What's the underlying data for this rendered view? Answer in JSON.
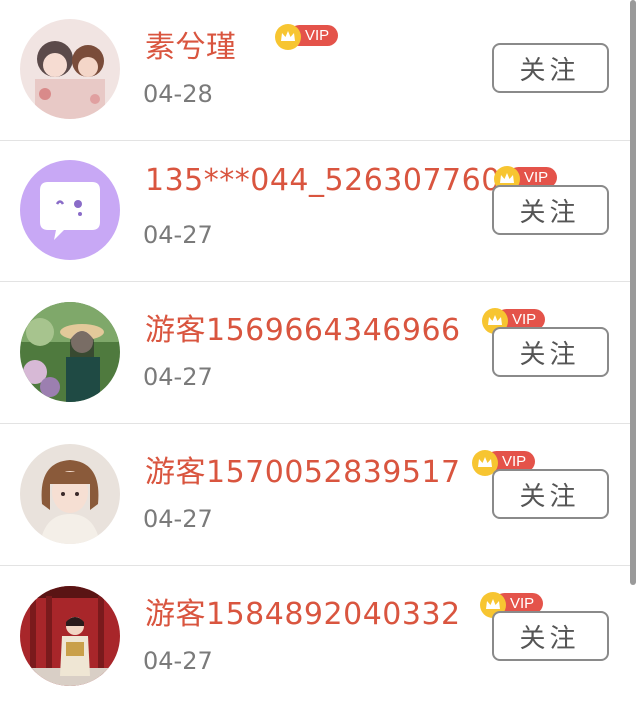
{
  "list": {
    "items": [
      {
        "username": "素兮瑾",
        "date": "04-28",
        "badge": "VIP",
        "follow_label": "关注",
        "avatar": "anime-illustration-avatar"
      },
      {
        "username": "135***044_5263077607",
        "date": "04-27",
        "badge": "VIP",
        "follow_label": "关注",
        "avatar": "default-chat-bubble-avatar"
      },
      {
        "username": "游客1569664346966",
        "date": "04-27",
        "badge": "VIP",
        "follow_label": "关注",
        "avatar": "outdoor-portrait-avatar"
      },
      {
        "username": "游客1570052839517",
        "date": "04-27",
        "badge": "VIP",
        "follow_label": "关注",
        "avatar": "girl-portrait-avatar"
      },
      {
        "username": "游客1584892040332",
        "date": "04-27",
        "badge": "VIP",
        "follow_label": "关注",
        "avatar": "red-corridor-portrait-avatar"
      }
    ]
  },
  "colors": {
    "username": "#d9553f",
    "vip_badge": "#e4534a",
    "crown": "#f7c531",
    "default_avatar": "#c8a8f5"
  }
}
